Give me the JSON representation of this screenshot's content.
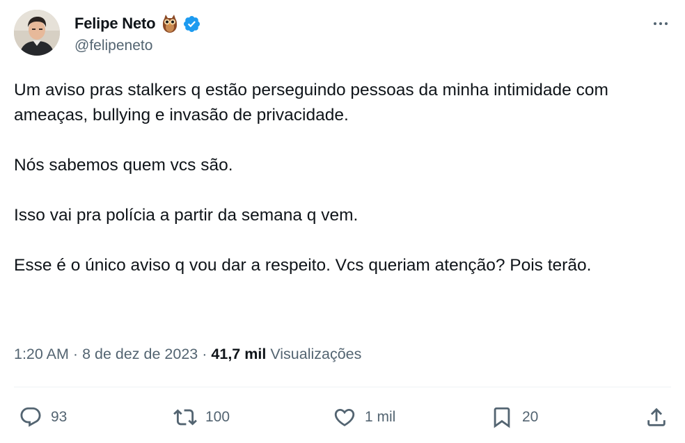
{
  "author": {
    "display_name": "Felipe Neto",
    "handle": "@felipeneto",
    "emoji_icon": "owl-emoji",
    "verified_icon": "verified-badge-icon"
  },
  "tweet": {
    "paragraphs": [
      "Um aviso pras stalkers q estão perseguindo pessoas da minha intimidade com ameaças, bullying e invasão de privacidade.",
      "Nós sabemos quem vcs são.",
      "Isso vai pra polícia a partir da semana q vem.",
      "Esse é o único aviso q vou dar a respeito. Vcs queriam atenção? Pois terão."
    ]
  },
  "meta": {
    "time": "1:20 AM",
    "separator": "·",
    "date": "8 de dez de 2023",
    "views_count": "41,7 mil",
    "views_label": "Visualizações"
  },
  "actions": {
    "reply": {
      "icon": "reply-icon",
      "count": "93"
    },
    "retweet": {
      "icon": "retweet-icon",
      "count": "100"
    },
    "like": {
      "icon": "heart-icon",
      "count": "1 mil"
    },
    "bookmark": {
      "icon": "bookmark-icon",
      "count": "20"
    },
    "share": {
      "icon": "share-icon"
    }
  },
  "colors": {
    "text_primary": "#0f1419",
    "text_secondary": "#536471",
    "verified_blue": "#1d9bf0",
    "divider": "#eff3f4"
  }
}
